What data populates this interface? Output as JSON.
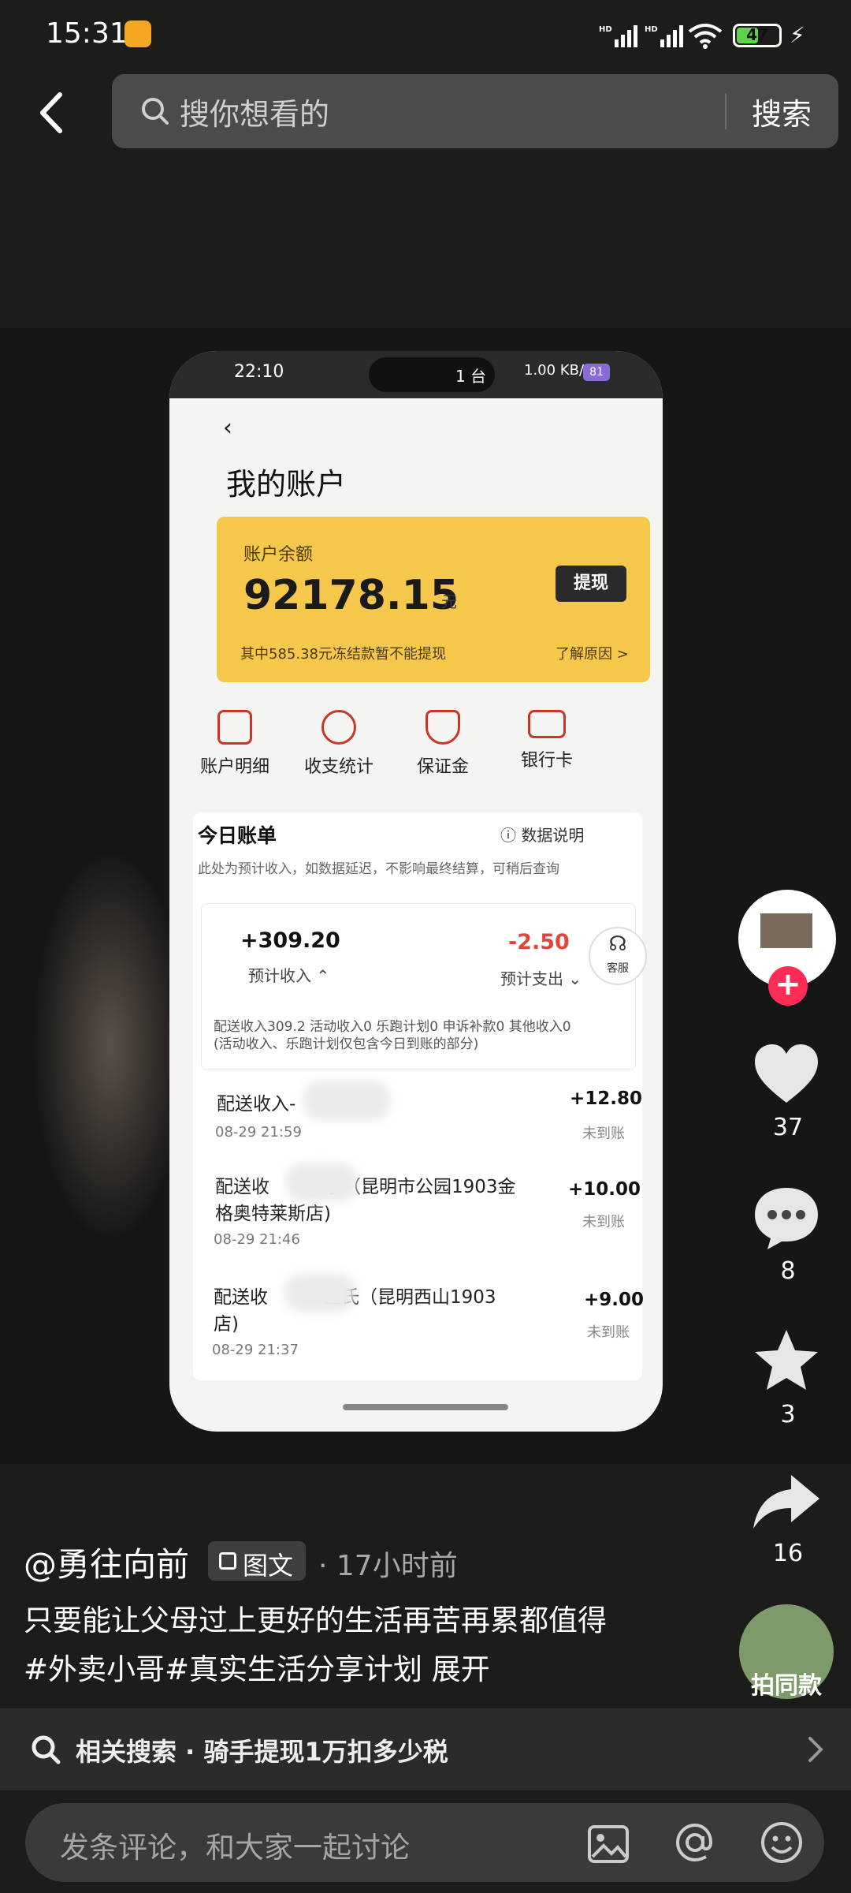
{
  "status_bar": {
    "time": "15:31",
    "battery": "47",
    "network1": "HD",
    "network2": "HD"
  },
  "search": {
    "placeholder": "搜你想看的",
    "button": "搜索"
  },
  "photo": {
    "phone_time": "22:10",
    "pill_text": "1 台",
    "phone_battery": "81",
    "phone_net": "1.00 KB/S",
    "page_title": "我的账户",
    "balance_label": "账户余额",
    "balance": "92178.15",
    "unit": "元",
    "withdraw": "提现",
    "frozen_note": "其中585.38元冻结款暂不能提现",
    "learn_reason": "了解原因 >",
    "quick": [
      {
        "label": "账户明细"
      },
      {
        "label": "收支统计"
      },
      {
        "label": "保证金"
      },
      {
        "label": "银行卡"
      }
    ],
    "bill_title": "今日账单",
    "data_desc": "数据说明",
    "note": "此处为预计收入，如数据延迟，不影响最终结算，可稍后查询",
    "income": "+309.20",
    "income_label": "预计收入",
    "expense": "-2.50",
    "expense_label": "预计支出",
    "service": "客服",
    "breakdown1": "配送收入309.2 活动收入0 乐跑计划0 申诉补款0 其他收入0",
    "breakdown2": "(活动收入、乐跑计划仅包含今日到账的部分)",
    "records": [
      {
        "title": "配送收入-",
        "title2": "",
        "time": "08-29 21:59",
        "amount": "+12.80",
        "status": "未到账"
      },
      {
        "title": "配送收",
        "title_tail": "宁（昆明市公园1903金",
        "title2": "格奥特莱斯店)",
        "time": "08-29 21:46",
        "amount": "+10.00",
        "status": "未到账"
      },
      {
        "title": "配送收",
        "title_tail": "臣氏（昆明西山1903",
        "title2": "店)",
        "time": "08-29 21:37",
        "amount": "+9.00",
        "status": "未到账"
      }
    ]
  },
  "side": {
    "likes": "37",
    "comments": "8",
    "favorites": "3",
    "shares": "16",
    "same_style": "拍同款"
  },
  "post": {
    "author": "@勇往向前",
    "type": "图文",
    "time": "· 17小时前",
    "caption_line1": "只要能让父母过上更好的生活再苦再累都值得",
    "caption_line2": "#外卖小哥#真实生活分享计划  展开"
  },
  "related": {
    "text": "相关搜索 · 骑手提现1万扣多少税"
  },
  "comment": {
    "placeholder": "发条评论，和大家一起讨论"
  },
  "colors": {
    "accent": "#ff2d55",
    "card": "#f5c84c",
    "expense": "#e0453b"
  }
}
